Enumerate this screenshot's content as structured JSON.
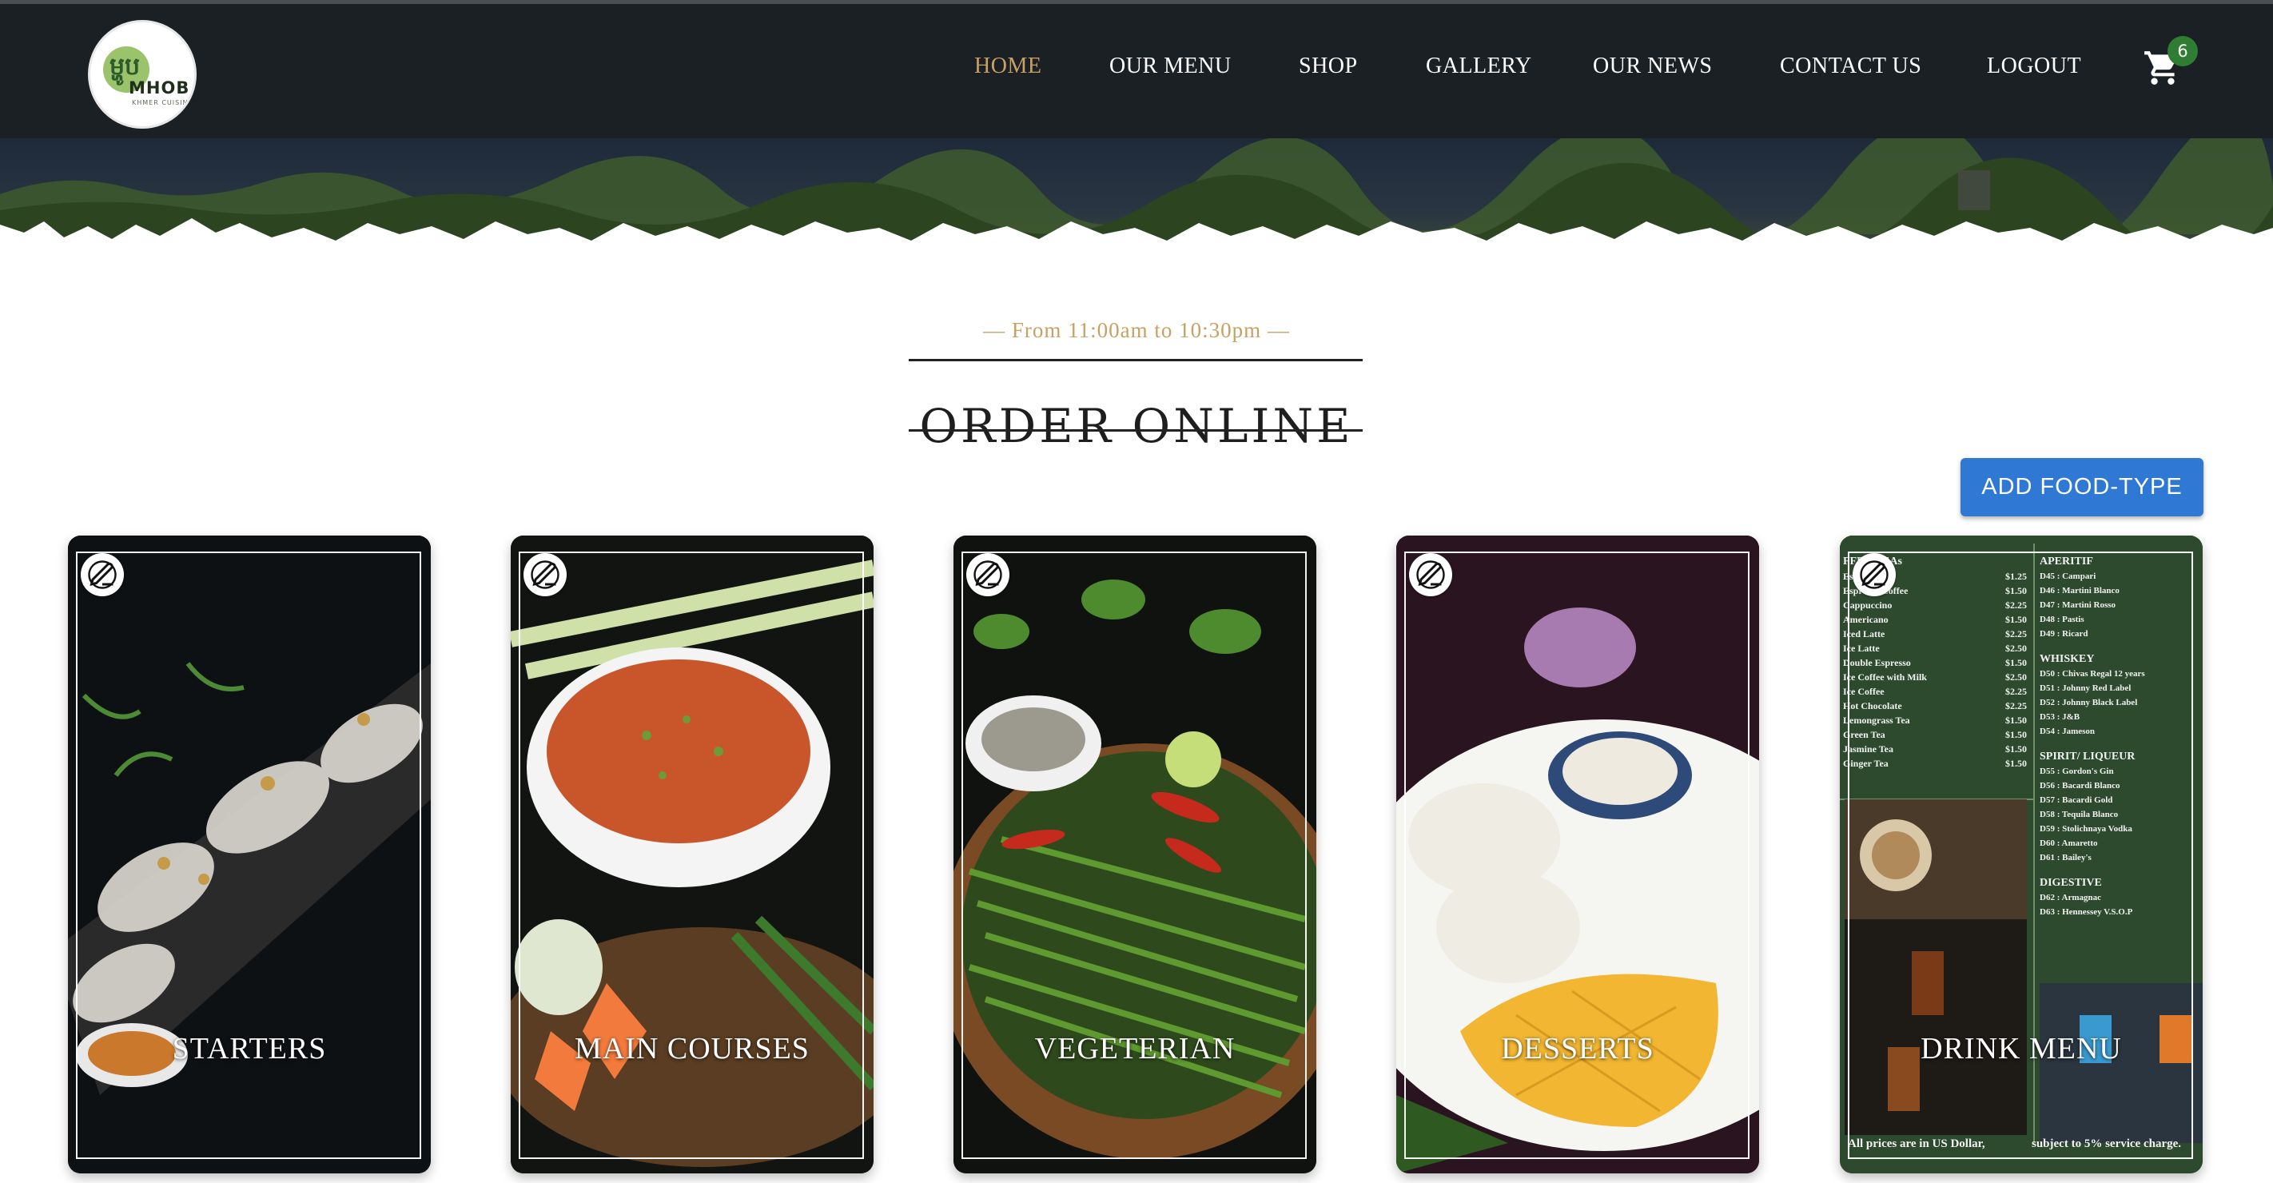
{
  "brand": {
    "logo_khmer": "ម្ហូប",
    "logo_name": "MHOB",
    "logo_sub": "KHMER CUISINE"
  },
  "nav": {
    "items": [
      {
        "label": "HOME",
        "active": true
      },
      {
        "label": "OUR MENU"
      },
      {
        "label": "SHOP"
      },
      {
        "label": "GALLERY"
      },
      {
        "label": "OUR NEWS"
      },
      {
        "label": "CONTACT US"
      },
      {
        "label": "LOGOUT"
      }
    ],
    "cart_icon": "shopping-cart-icon",
    "cart_count": "6"
  },
  "section": {
    "hours": "— From 11:00am to 10:30pm —",
    "title": "ORDER ONLINE",
    "add_button": "ADD FOOD-TYPE"
  },
  "cards": [
    {
      "label": "STARTERS",
      "edit_icon": "edit-icon"
    },
    {
      "label": "MAIN COURSES",
      "edit_icon": "edit-icon"
    },
    {
      "label": "VEGETERIAN",
      "edit_icon": "edit-icon"
    },
    {
      "label": "DESSERTS",
      "edit_icon": "edit-icon"
    },
    {
      "label": "DRINK MENU",
      "edit_icon": "edit-icon"
    }
  ],
  "drink_menu": {
    "left_header": "FFEE/TEAs",
    "left_items": [
      {
        "name": "Espresso",
        "price": "$1.25"
      },
      {
        "name": "Espresso Coffee",
        "price": "$1.50"
      },
      {
        "name": "Cappuccino",
        "price": "$2.25"
      },
      {
        "name": "Americano",
        "price": "$1.50"
      },
      {
        "name": "Iced Latte",
        "price": "$2.25"
      },
      {
        "name": "Ice Latte",
        "price": "$2.50"
      },
      {
        "name": "Double Espresso",
        "price": "$1.50"
      },
      {
        "name": "Ice Coffee with Milk",
        "price": "$2.50"
      },
      {
        "name": "Ice Coffee",
        "price": "$2.25"
      },
      {
        "name": "Hot Chocolate",
        "price": "$2.25"
      },
      {
        "name": "Lemongrass Tea",
        "price": "$1.50"
      },
      {
        "name": "Green Tea",
        "price": "$1.50"
      },
      {
        "name": "Jasmine Tea",
        "price": "$1.50"
      },
      {
        "name": "Ginger Tea",
        "price": "$1.50"
      }
    ],
    "aperitif_header": "APERITIF",
    "aperitif_items": [
      {
        "code": "D45",
        "name": "Campari"
      },
      {
        "code": "D46",
        "name": "Martini Blanco"
      },
      {
        "code": "D47",
        "name": "Martini Rosso"
      },
      {
        "code": "D48",
        "name": "Pastis"
      },
      {
        "code": "D49",
        "name": "Ricard"
      }
    ],
    "whiskey_header": "WHISKEY",
    "whiskey_items": [
      {
        "code": "D50",
        "name": "Chivas Regal 12 years"
      },
      {
        "code": "D51",
        "name": "Johnny Red Label"
      },
      {
        "code": "D52",
        "name": "Johnny Black Label"
      },
      {
        "code": "D53",
        "name": "J&B"
      },
      {
        "code": "D54",
        "name": "Jameson"
      }
    ],
    "spirit_header": "SPIRIT/ LIQUEUR",
    "spirit_items": [
      {
        "code": "D55",
        "name": "Gordon's Gin"
      },
      {
        "code": "D56",
        "name": "Bacardi Blanco"
      },
      {
        "code": "D57",
        "name": "Bacardi Gold"
      },
      {
        "code": "D58",
        "name": "Tequila Blanco"
      },
      {
        "code": "D59",
        "name": "Stolichnaya Vodka"
      },
      {
        "code": "D60",
        "name": "Amaretto"
      },
      {
        "code": "D61",
        "name": "Bailey's"
      }
    ],
    "digestive_header": "DIGESTIVE",
    "digestive_items": [
      {
        "code": "D62",
        "name": "Armagnac"
      },
      {
        "code": "D63",
        "name": "Hennessey V.S.O.P"
      }
    ],
    "footer_left": "All prices are in US Dollar,",
    "footer_right": "subject to 5% service charge."
  },
  "colors": {
    "navbar": "#1b2024",
    "accent_gold": "#c9a063",
    "button_blue": "#2f79d4",
    "badge_green": "#2e7d32"
  }
}
